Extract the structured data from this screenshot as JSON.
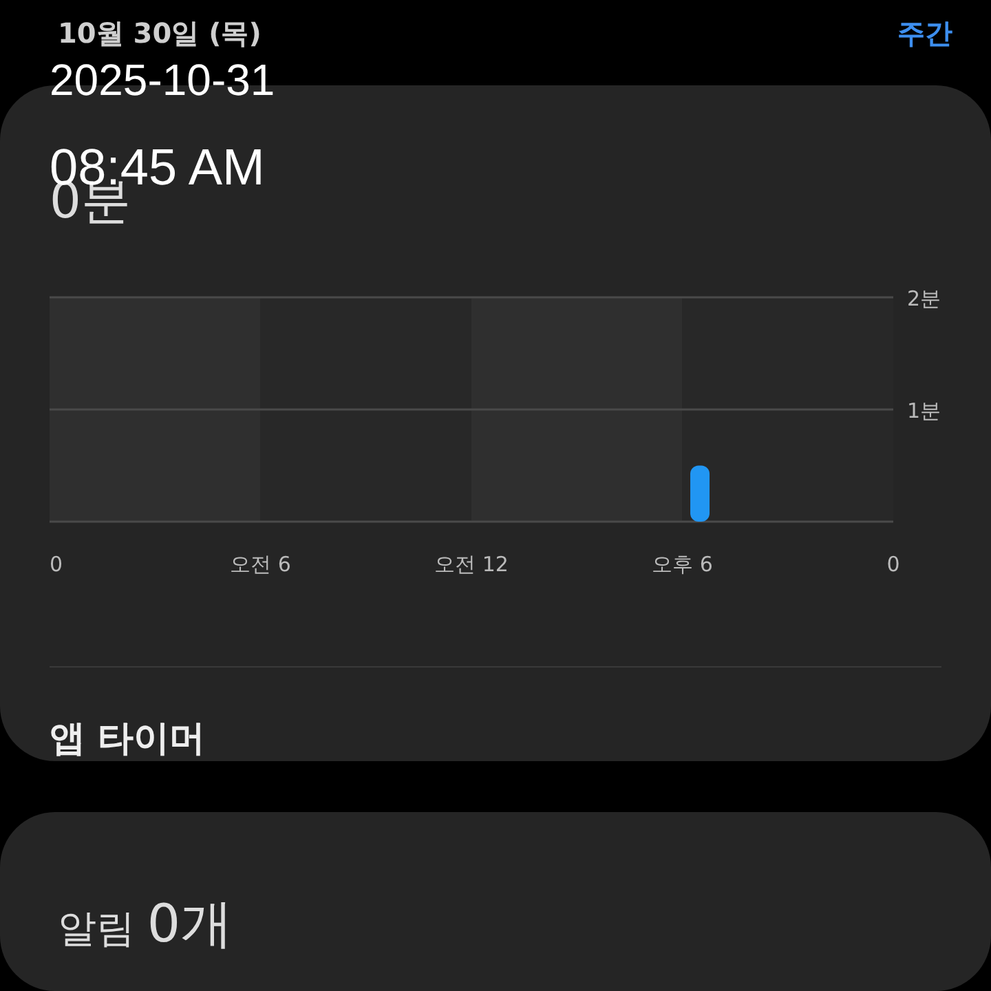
{
  "header": {
    "date": "10월 30일 (목)",
    "view_link": "주간"
  },
  "overlay": {
    "date": "2025-10-31",
    "time": "08:45 AM"
  },
  "usage_card": {
    "total": "0분",
    "chart_data": {
      "type": "bar",
      "categories": [
        "0",
        null,
        null,
        null,
        null,
        null,
        "오전 6",
        null,
        null,
        null,
        null,
        null,
        "오전 12",
        null,
        null,
        null,
        null,
        null,
        "오후 6",
        null,
        null,
        null,
        null,
        null,
        "0"
      ],
      "series": [
        {
          "color": "#2196f3",
          "values": [
            0,
            0,
            0,
            0,
            0,
            0,
            0,
            0,
            0,
            0,
            0,
            0,
            0,
            0,
            0,
            0,
            0,
            0,
            0.5,
            0,
            0,
            0,
            0,
            0,
            null
          ]
        }
      ],
      "ylim": [
        0,
        2
      ],
      "yticks": [
        {
          "value": 1,
          "label": "1분"
        },
        {
          "value": 2,
          "label": "2분"
        }
      ]
    },
    "app_timer": "앱 타이머"
  },
  "notification_card": {
    "label": "알림",
    "count": "0개"
  }
}
